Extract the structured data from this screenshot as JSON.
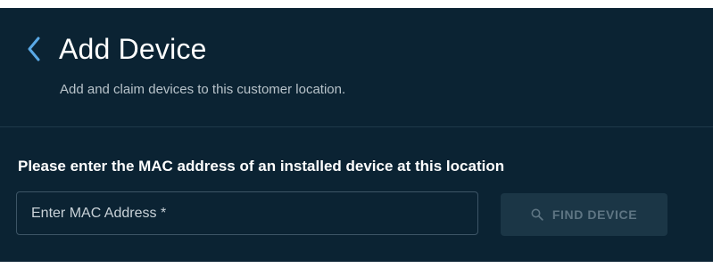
{
  "header": {
    "title": "Add Device",
    "subtitle": "Add and claim devices to this customer location."
  },
  "form": {
    "prompt": "Please enter the MAC address of an installed device at this location",
    "mac_placeholder": "Enter MAC Address *",
    "find_button_label": "FIND DEVICE",
    "find_button_state": "disabled"
  },
  "icons": {
    "back": "chevron-left-icon",
    "find": "search-icon"
  },
  "colors": {
    "panel_background": "#0b2333",
    "accent_back_chevron": "#5aa9e6",
    "disabled_button_background": "#1b3646",
    "disabled_button_text": "#5e7583"
  }
}
